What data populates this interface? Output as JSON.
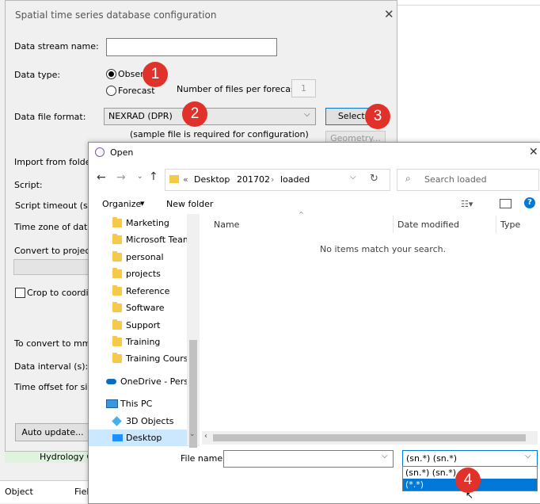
{
  "config_dialog": {
    "title": "Spatial time series database configuration",
    "close": "✕",
    "data_stream_name_label": "Data stream name:",
    "data_stream_name_value": "",
    "data_type_label": "Data type:",
    "radio_observed": "Observ",
    "radio_forecast": "Forecast",
    "files_per_forecast_label": "Number of files per forecast:",
    "files_per_forecast_value": "1",
    "data_file_format_label": "Data file format:",
    "data_file_format_value": "NEXRAD (DPR)",
    "select_file_button": "Select fi",
    "sample_note": "(sample file is required for configuration)",
    "geometry_button": "Geometry...",
    "import_from_folder_label": "Import from folder:",
    "script_label": "Script:",
    "script_timeout_label": "Script timeout (s)",
    "time_zone_label": "Time zone of data:",
    "convert_projection_label": "Convert to projectio",
    "crop_label": "Crop to coordina",
    "convert_mm_label": "To convert to mm/h",
    "data_interval_label": "Data interval (s):",
    "time_offset_label": "Time offset for simu",
    "auto_update_button": "Auto update..."
  },
  "background": {
    "hydrology_label": "Hydrology O",
    "object_label": "Object",
    "field_label": "Fiel"
  },
  "badges": [
    "1",
    "2",
    "3",
    "4"
  ],
  "open_dialog": {
    "title": "Open",
    "close": "✕",
    "breadcrumb": [
      "«",
      "Desktop",
      "201702",
      "loaded"
    ],
    "search_placeholder": "Search loaded",
    "organize": "Organize",
    "new_folder": "New folder",
    "nav_items": [
      {
        "label": "Marketing",
        "icon": "folder-icon"
      },
      {
        "label": "Microsoft Teams",
        "icon": "folder-icon"
      },
      {
        "label": "personal",
        "icon": "folder-icon"
      },
      {
        "label": "projects",
        "icon": "folder-icon"
      },
      {
        "label": "Reference",
        "icon": "folder-icon"
      },
      {
        "label": "Software",
        "icon": "folder-icon"
      },
      {
        "label": "Support",
        "icon": "folder-icon"
      },
      {
        "label": "Training",
        "icon": "folder-icon"
      },
      {
        "label": "Training Courses",
        "icon": "shared-folder-icon"
      },
      {
        "label": "OneDrive - Persor",
        "icon": "cloud-icon"
      },
      {
        "label": "This PC",
        "icon": "pc-icon"
      },
      {
        "label": "3D Objects",
        "icon": "cube-icon"
      },
      {
        "label": "Desktop",
        "icon": "desktop-icon"
      }
    ],
    "columns": [
      "Name",
      "Date modified",
      "Type"
    ],
    "empty_message": "No items match your search.",
    "file_name_label": "File name:",
    "file_name_value": "",
    "file_type_selected": "(sn.*) (sn.*)",
    "file_type_options": [
      "(sn.*) (sn.*)",
      "(*.*)"
    ],
    "colors": {
      "accent": "#0078d7",
      "badge": "#e0322a",
      "folder": "#f7c948"
    }
  }
}
